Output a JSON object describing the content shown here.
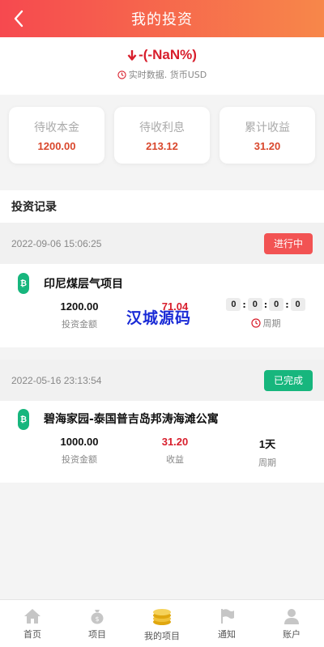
{
  "header": {
    "title": "我的投资"
  },
  "summary": {
    "value": "-(-NaN%)",
    "subtitle": "实时数据. 货币USD"
  },
  "stats": [
    {
      "label": "待收本金",
      "value": "1200.00"
    },
    {
      "label": "待收利息",
      "value": "213.12"
    },
    {
      "label": "累计收益",
      "value": "31.20"
    }
  ],
  "records": {
    "title": "投资记录",
    "items": [
      {
        "time": "2022-09-06 15:06:25",
        "status": "进行中",
        "name": "印尼煤层气项目",
        "amount": "1200.00",
        "amount_label": "投资金额",
        "income": "71.04",
        "countdown": [
          "0",
          "0",
          "0",
          "0"
        ],
        "period_label": "周期"
      },
      {
        "time": "2022-05-16 23:13:54",
        "status": "已完成",
        "name": "碧海家园-泰国普吉岛邦涛海滩公寓",
        "amount": "1000.00",
        "amount_label": "投资金额",
        "income": "31.20",
        "income_label": "收益",
        "period": "1天",
        "period_label": "周期"
      }
    ]
  },
  "watermark": "汉城源码",
  "tabbar": [
    {
      "label": "首页",
      "icon": "home-icon"
    },
    {
      "label": "项目",
      "icon": "moneybag-icon"
    },
    {
      "label": "我的项目",
      "icon": "coins-icon"
    },
    {
      "label": "通知",
      "icon": "flag-icon"
    },
    {
      "label": "账户",
      "icon": "user-icon"
    }
  ],
  "colors": {
    "accent_start": "#f6494f",
    "accent_end": "#f7874a",
    "red": "#d81e2c",
    "green": "#17b67d",
    "status_red": "#f25353"
  }
}
